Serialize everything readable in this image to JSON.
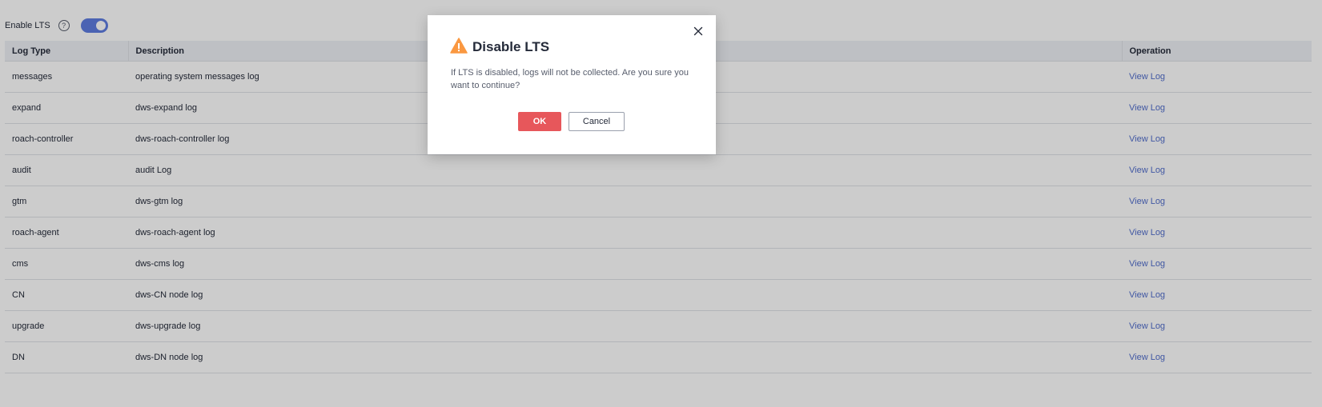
{
  "lts": {
    "label": "Enable LTS",
    "help_icon": "question-circle-icon",
    "toggle_on": true
  },
  "table": {
    "headers": {
      "type": "Log Type",
      "description": "Description",
      "operation": "Operation"
    },
    "rows": [
      {
        "type": "messages",
        "description": "operating system messages log",
        "action": "View Log"
      },
      {
        "type": "expand",
        "description": "dws-expand log",
        "action": "View Log"
      },
      {
        "type": "roach-controller",
        "description": "dws-roach-controller log",
        "action": "View Log"
      },
      {
        "type": "audit",
        "description": "audit Log",
        "action": "View Log"
      },
      {
        "type": "gtm",
        "description": "dws-gtm log",
        "action": "View Log"
      },
      {
        "type": "roach-agent",
        "description": "dws-roach-agent log",
        "action": "View Log"
      },
      {
        "type": "cms",
        "description": "dws-cms log",
        "action": "View Log"
      },
      {
        "type": "CN",
        "description": "dws-CN node log",
        "action": "View Log"
      },
      {
        "type": "upgrade",
        "description": "dws-upgrade log",
        "action": "View Log"
      },
      {
        "type": "DN",
        "description": "dws-DN node log",
        "action": "View Log"
      }
    ]
  },
  "dialog": {
    "title": "Disable LTS",
    "message": "If LTS is disabled, logs will not be collected. Are you sure you want to continue?",
    "ok_label": "OK",
    "cancel_label": "Cancel",
    "icons": {
      "warning": "warning-triangle-icon",
      "close": "close-icon"
    }
  },
  "colors": {
    "accent": "#5e7ce0",
    "link": "#526ecc",
    "danger": "#e7575b",
    "warning": "#fa9841",
    "overlay": "rgba(0,0,0,0.2)"
  }
}
